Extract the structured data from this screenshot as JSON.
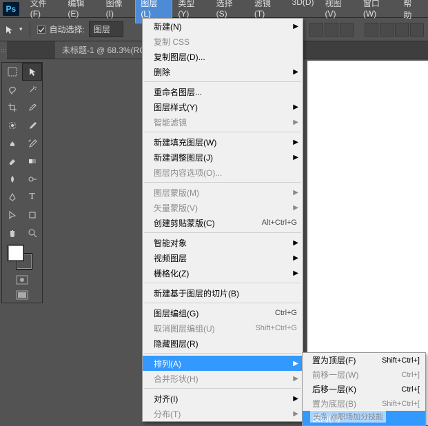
{
  "menubar": {
    "items": [
      "文件(F)",
      "编辑(E)",
      "图像(I)",
      "图层(L)",
      "类型(Y)",
      "选择(S)",
      "滤镜(T)",
      "3D(D)",
      "视图(V)",
      "窗口(W)",
      "帮助"
    ],
    "activeIndex": 3
  },
  "toolbar": {
    "autoSelectLabel": "自动选择:",
    "autoSelectTarget": "图层"
  },
  "tab": {
    "title": "未标题-1 @ 68.3%(RG"
  },
  "dropdown": [
    {
      "label": "新建(N)",
      "arrow": true
    },
    {
      "label": "复制 CSS",
      "disabled": true
    },
    {
      "label": "复制图层(D)..."
    },
    {
      "label": "删除",
      "arrow": true
    },
    {
      "sep": true
    },
    {
      "label": "重命名图层..."
    },
    {
      "label": "图层样式(Y)",
      "arrow": true
    },
    {
      "label": "智能滤镜",
      "disabled": true,
      "arrow": true
    },
    {
      "sep": true
    },
    {
      "label": "新建填充图层(W)",
      "arrow": true
    },
    {
      "label": "新建调整图层(J)",
      "arrow": true
    },
    {
      "label": "图层内容选项(O)...",
      "disabled": true
    },
    {
      "sep": true
    },
    {
      "label": "图层蒙版(M)",
      "arrow": true,
      "disabled": true
    },
    {
      "label": "矢量蒙版(V)",
      "arrow": true,
      "disabled": true
    },
    {
      "label": "创建剪贴蒙版(C)",
      "shortcut": "Alt+Ctrl+G"
    },
    {
      "sep": true
    },
    {
      "label": "智能对象",
      "arrow": true
    },
    {
      "label": "视频图层",
      "arrow": true
    },
    {
      "label": "栅格化(Z)",
      "arrow": true
    },
    {
      "sep": true
    },
    {
      "label": "新建基于图层的切片(B)"
    },
    {
      "sep": true
    },
    {
      "label": "图层编组(G)",
      "shortcut": "Ctrl+G"
    },
    {
      "label": "取消图层编组(U)",
      "shortcut": "Shift+Ctrl+G",
      "disabled": true
    },
    {
      "label": "隐藏图层(R)"
    },
    {
      "sep": true
    },
    {
      "label": "排列(A)",
      "arrow": true,
      "highlight": true
    },
    {
      "label": "合并形状(H)",
      "arrow": true,
      "disabled": true
    },
    {
      "sep": true
    },
    {
      "label": "对齐(I)",
      "arrow": true
    },
    {
      "label": "分布(T)",
      "arrow": true,
      "disabled": true
    }
  ],
  "submenu": [
    {
      "label": "置为顶层(F)",
      "shortcut": "Shift+Ctrl+]"
    },
    {
      "label": "前移一层(W)",
      "shortcut": "Ctrl+]",
      "disabled": true
    },
    {
      "label": "后移一层(K)",
      "shortcut": "Ctrl+["
    },
    {
      "label": "置为底层(B)",
      "shortcut": "Shift+Ctrl+[",
      "disabled": true
    },
    {
      "label": "反向(R)",
      "highlight": true,
      "disabled": true
    }
  ],
  "watermark": "头条 @职场加分技能"
}
